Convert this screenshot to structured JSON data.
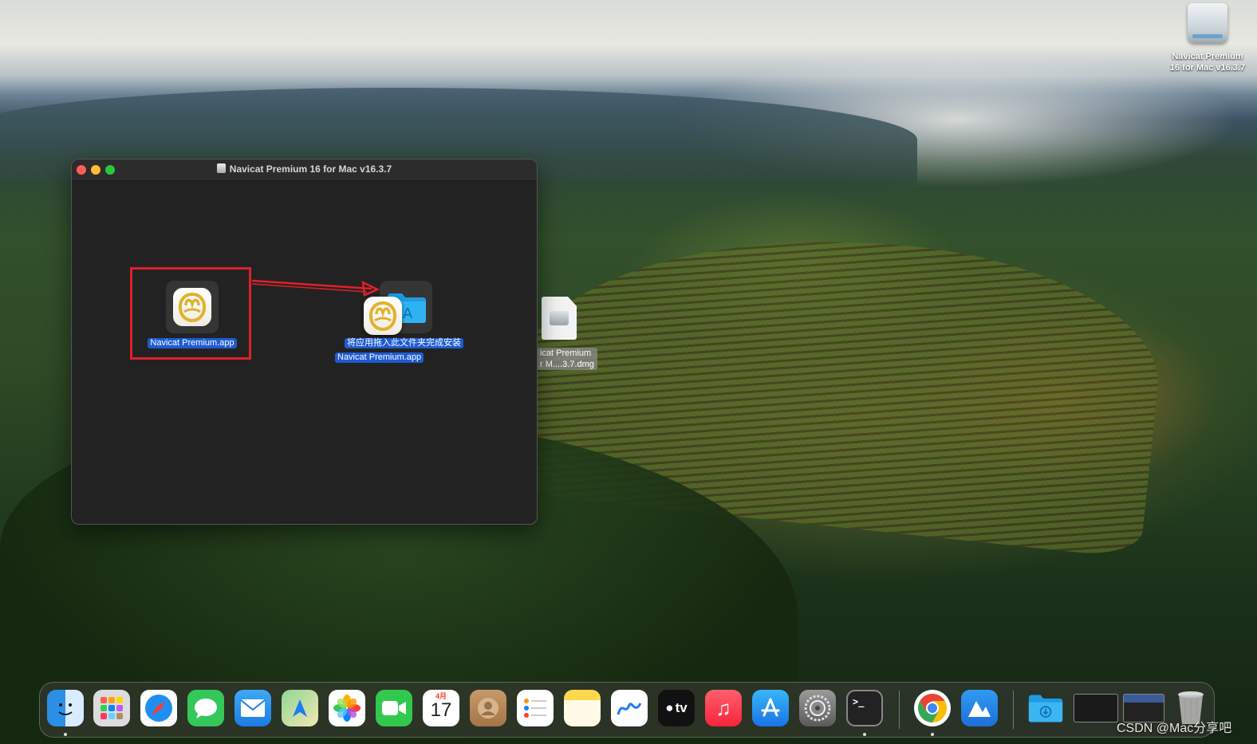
{
  "desktop": {
    "disk_label": "Navicat Premium 16 for Mac v16.3.7",
    "dmg_label_line1": "icat Premium",
    "dmg_label_line2": "r M....3.7.dmg"
  },
  "window": {
    "title": "Navicat Premium 16 for Mac v16.3.7",
    "source_app_label": "Navicat Premium.app",
    "target_hint_label": "将应用拖入此文件夹完成安装",
    "dragging_label": "Navicat Premium.app",
    "highlight_color": "#e0202a"
  },
  "dock": {
    "calendar_month": "4月",
    "calendar_day": "17",
    "tv_label": "tv",
    "items": [
      "Finder",
      "Launchpad",
      "Safari",
      "Messages",
      "Mail",
      "Maps",
      "Photos",
      "FaceTime",
      "Calendar",
      "Contacts",
      "Reminders",
      "Notes",
      "Freeform",
      "TV",
      "Music",
      "App Store",
      "System Settings",
      "Terminal",
      "Chrome",
      "Navicat",
      "Downloads",
      "Recent window",
      "Recent window",
      "Trash"
    ]
  },
  "watermark": "CSDN @Mac分享吧"
}
